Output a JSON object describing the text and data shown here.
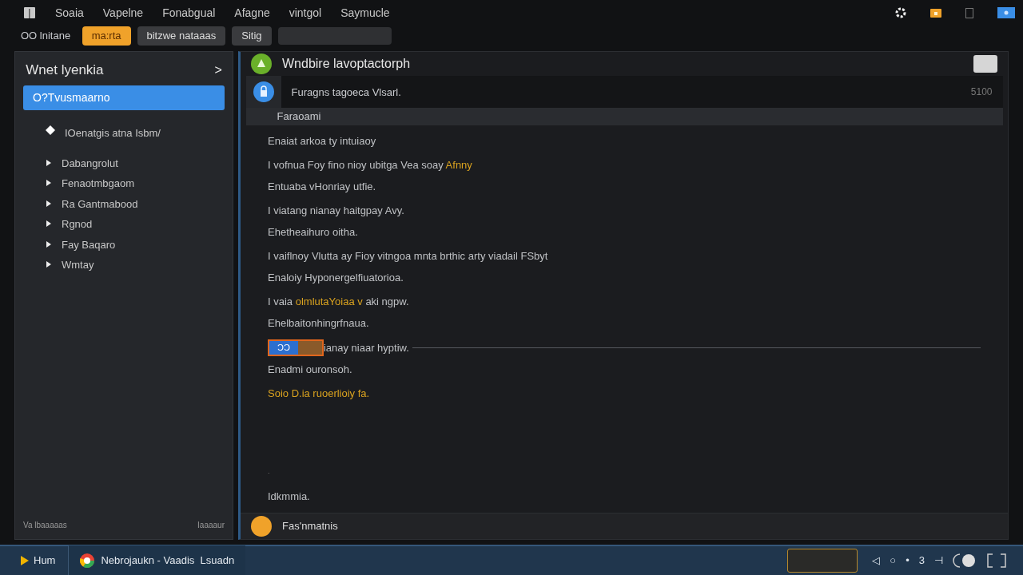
{
  "menu_bar": {
    "items": [
      "Soaia",
      "Vapelne",
      "Fonabgual",
      "Afagne",
      "vintgol",
      "Saymucle"
    ]
  },
  "toolbar": {
    "label": "OO lnitane",
    "tabs": [
      {
        "label": "ma:rta",
        "selected": true
      },
      {
        "label": "bitzwe nataaas",
        "selected": false
      },
      {
        "label": "Sitig",
        "selected": false
      }
    ]
  },
  "sidebar": {
    "title": "Wnet lyenkia",
    "chevron": ">",
    "items": [
      {
        "label": "O?Tvusmaarno",
        "kind": "plain",
        "selected": true
      },
      {
        "label": "IOenatgis atna Isbm/",
        "kind": "diamond",
        "selected": false
      },
      {
        "label": "Dabangrolut",
        "kind": "tree",
        "selected": false
      },
      {
        "label": "Fenaotmbgaom",
        "kind": "tree",
        "selected": false
      },
      {
        "label": "Ra Gantmabood",
        "kind": "tree",
        "selected": false
      },
      {
        "label": "Rgnod",
        "kind": "tree",
        "selected": false
      },
      {
        "label": "Fay Baqaro",
        "kind": "tree",
        "selected": false
      },
      {
        "label": "Wmtay",
        "kind": "tree",
        "selected": false
      }
    ],
    "footer_left": "Va lbaaaaas",
    "footer_right": "Iaaaaur"
  },
  "main": {
    "title": "Wndbire lavoptactorph",
    "message": {
      "text": "Furagns tagoeca Vlsarl.",
      "count": "5100"
    },
    "subheader": "Faraoami",
    "lines": [
      {
        "kind": "text",
        "parts": [
          {
            "text": "Enaiat arkoa ty intuiaoy",
            "accent": false
          }
        ]
      },
      {
        "kind": "text",
        "parts": [
          {
            "text": "I vofnua Foy fino nioy ubitga Vea soay ",
            "accent": false
          },
          {
            "text": "Afnny",
            "accent": true
          }
        ]
      },
      {
        "kind": "text",
        "parts": [
          {
            "text": "Entuaba vHonriay utfie.",
            "accent": false
          }
        ]
      },
      {
        "kind": "text",
        "parts": [
          {
            "text": "I viatang nianay haitgpay Avy.",
            "accent": false
          }
        ]
      },
      {
        "kind": "text",
        "parts": [
          {
            "text": "Ehetheaihuro oitha.",
            "accent": false
          }
        ]
      },
      {
        "kind": "text",
        "parts": [
          {
            "text": "I vaiflnoy Vlutta ay Fioy vitngoa mnta brthic arty viadail FSbyt",
            "accent": false
          }
        ]
      },
      {
        "kind": "text",
        "parts": [
          {
            "text": "Enaloiy Hyponergelfiuatorioa.",
            "accent": false
          }
        ]
      },
      {
        "kind": "text",
        "parts": [
          {
            "text": "I vaia ",
            "accent": false
          },
          {
            "text": "olmlutaYoiaa v",
            "accent": true
          },
          {
            "text": " aki ngpw.",
            "accent": false
          }
        ]
      },
      {
        "kind": "text",
        "parts": [
          {
            "text": "Ehelbaitonhingrfnaua.",
            "accent": false
          }
        ]
      },
      {
        "kind": "marker",
        "badge": "ƆƆ",
        "parts": [
          {
            "text": "ianay niaar hyptiw.",
            "accent": false
          }
        ]
      },
      {
        "kind": "text",
        "parts": [
          {
            "text": "Enadmi ouronsoh.",
            "accent": false
          }
        ]
      },
      {
        "kind": "text",
        "parts": [
          {
            "text": "Soio D.ia ruoerlioiy fa.",
            "accent": true
          }
        ]
      }
    ],
    "dot": ".",
    "footnote": "Idkmmia.",
    "bottom_label": "Fas'nmatnis"
  },
  "taskbar": {
    "start": "Hum",
    "app": "Nebrojaukn - Vaadis  Lsuadn",
    "tray": [
      "◁",
      "○",
      "•",
      "3",
      "⊣"
    ]
  }
}
